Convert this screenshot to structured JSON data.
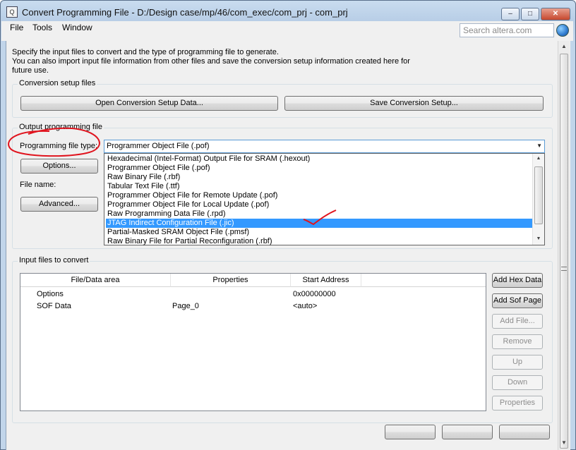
{
  "window": {
    "title": "Convert Programming File - D:/Design case/mp/46/com_exec/com_prj - com_prj",
    "minimize": "–",
    "maximize": "□",
    "close": "✕"
  },
  "menu": {
    "file": "File",
    "tools": "Tools",
    "window": "Window"
  },
  "search": {
    "placeholder": "Search altera.com"
  },
  "intro": {
    "line1": "Specify the input files to convert and the type of programming file to generate.",
    "line2": "You can also import input file information from other files and save the conversion setup information created here for future use."
  },
  "conversion_setup": {
    "title": "Conversion setup files",
    "open_button": "Open Conversion Setup Data...",
    "save_button": "Save Conversion Setup..."
  },
  "output": {
    "title": "Output programming file",
    "type_label": "Programming file type:",
    "selected_type": "Programmer Object File (.pof)",
    "options_button": "Options...",
    "file_name_label": "File name:",
    "advanced_button": "Advanced...",
    "dropdown_items": [
      "Hexadecimal (Intel-Format) Output File for SRAM (.hexout)",
      "Programmer Object File (.pof)",
      "Raw Binary File (.rbf)",
      "Tabular Text File (.ttf)",
      "Programmer Object File for Remote Update (.pof)",
      "Programmer Object File for Local Update (.pof)",
      "Raw Programming Data File (.rpd)",
      "JTAG Indirect Configuration File (.jic)",
      "Partial-Masked SRAM Object File (.pmsf)",
      "Raw Binary File for Partial Reconfiguration (.rbf)"
    ],
    "highlighted_index": 7
  },
  "input_files": {
    "title": "Input files to convert",
    "columns": [
      "File/Data area",
      "Properties",
      "Start Address"
    ],
    "rows": [
      {
        "area": "Options",
        "properties": "",
        "address": "0x00000000"
      },
      {
        "area": "SOF Data",
        "properties": "Page_0",
        "address": "<auto>"
      }
    ],
    "buttons": {
      "add_hex": "Add Hex Data",
      "add_sof": "Add Sof Page",
      "add_file": "Add File...",
      "remove": "Remove",
      "up": "Up",
      "down": "Down",
      "properties": "Properties"
    }
  },
  "colors": {
    "selection": "#3399ff",
    "annotation": "#e0141e"
  }
}
